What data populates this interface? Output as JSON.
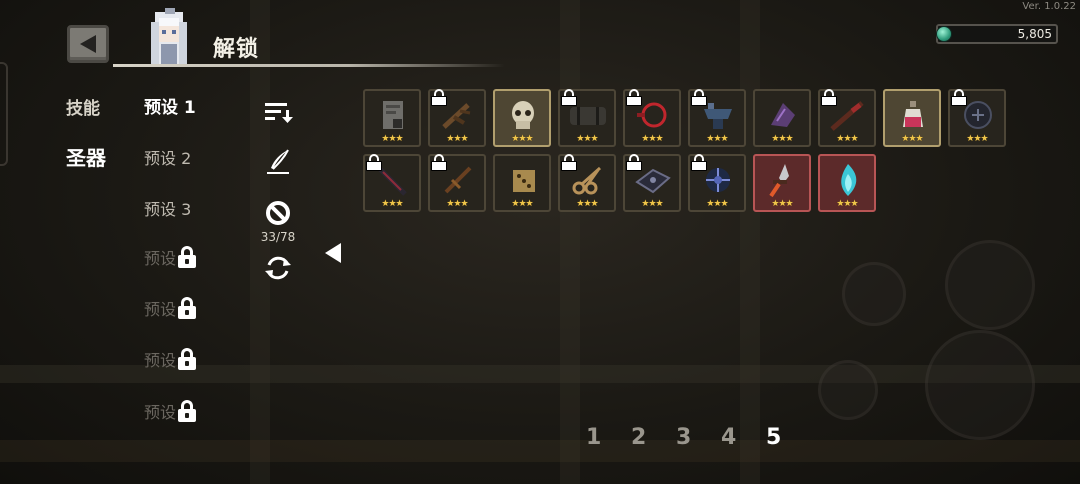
{
  "version": "Ver. 1.0.22",
  "header": {
    "title": "解锁"
  },
  "currency": {
    "value": "5,805"
  },
  "categories": [
    {
      "label": "技能",
      "active": false
    },
    {
      "label": "圣器",
      "active": true
    }
  ],
  "presets": [
    {
      "label": "预设 1",
      "locked": false,
      "active": true
    },
    {
      "label": "预设 2",
      "locked": false,
      "active": false
    },
    {
      "label": "预设 3",
      "locked": false,
      "active": false
    },
    {
      "label": "预设",
      "locked": true,
      "active": false
    },
    {
      "label": "预设",
      "locked": true,
      "active": false
    },
    {
      "label": "预设",
      "locked": true,
      "active": false
    },
    {
      "label": "预设",
      "locked": true,
      "active": false
    }
  ],
  "tools": {
    "counter": "33/78"
  },
  "relics": [
    {
      "name": "scroll-relic",
      "locked": false,
      "frame": "normal",
      "stars": 3
    },
    {
      "name": "branch-relic",
      "locked": true,
      "frame": "normal",
      "stars": 3
    },
    {
      "name": "skull-relic",
      "locked": false,
      "frame": "gold",
      "stars": 3
    },
    {
      "name": "barrel-relic",
      "locked": true,
      "frame": "normal",
      "stars": 3
    },
    {
      "name": "red-ring-relic",
      "locked": true,
      "frame": "normal",
      "stars": 3
    },
    {
      "name": "anvil-relic",
      "locked": true,
      "frame": "normal",
      "stars": 3
    },
    {
      "name": "purple-crystal-relic",
      "locked": false,
      "frame": "normal",
      "stars": 3
    },
    {
      "name": "red-staff-relic",
      "locked": true,
      "frame": "normal",
      "stars": 3
    },
    {
      "name": "potion-relic",
      "locked": false,
      "frame": "gold",
      "stars": 3
    },
    {
      "name": "dark-orb-relic",
      "locked": true,
      "frame": "normal",
      "stars": 3
    },
    {
      "name": "red-blade-relic",
      "locked": true,
      "frame": "normal",
      "stars": 3
    },
    {
      "name": "sword-relic",
      "locked": true,
      "frame": "normal",
      "stars": 3
    },
    {
      "name": "dice-relic",
      "locked": false,
      "frame": "normal",
      "stars": 3
    },
    {
      "name": "scissors-relic",
      "locked": true,
      "frame": "normal",
      "stars": 3
    },
    {
      "name": "dark-tablet-relic",
      "locked": true,
      "frame": "normal",
      "stars": 3
    },
    {
      "name": "blue-orb-relic",
      "locked": true,
      "frame": "normal",
      "stars": 3
    },
    {
      "name": "dagger-relic",
      "locked": false,
      "frame": "red",
      "stars": 3
    },
    {
      "name": "cyan-flame-relic",
      "locked": false,
      "frame": "red",
      "stars": 3
    }
  ],
  "pager": {
    "pages": [
      "1",
      "2",
      "3",
      "4",
      "5"
    ],
    "active": 4
  }
}
